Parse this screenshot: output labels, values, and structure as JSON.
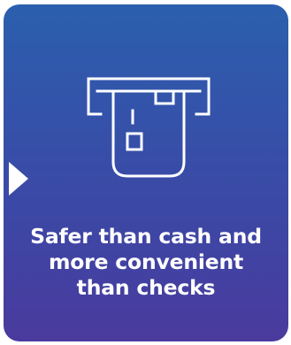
{
  "card": {
    "caption_lines": [
      "Safer than cash and",
      "more convenient",
      "than checks"
    ]
  },
  "icons": {
    "main": "card-in-atm-slot-icon",
    "pointer": "triangle-pointer-icon"
  },
  "colors": {
    "gradient_top": "#2b5fae",
    "gradient_bottom": "#4a3a9e",
    "foreground": "#ffffff"
  }
}
